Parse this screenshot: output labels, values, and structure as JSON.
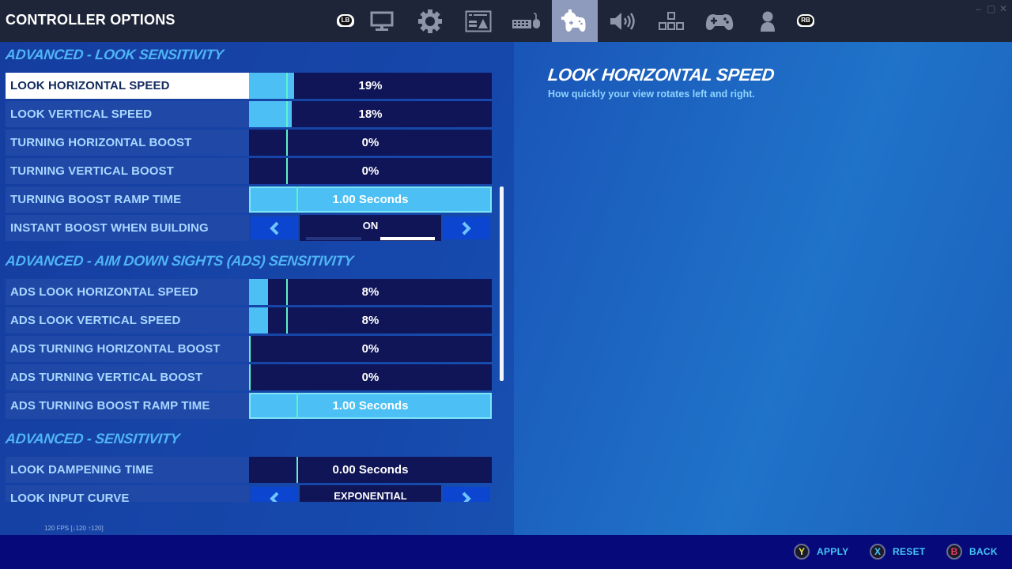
{
  "header": {
    "title": "CONTROLLER OPTIONS",
    "left_bumper": "LB",
    "right_bumper": "RB",
    "tabs": [
      {
        "icon": "monitor-icon",
        "name": "display"
      },
      {
        "icon": "gear-icon",
        "name": "game"
      },
      {
        "icon": "brightness-icon",
        "name": "brightness"
      },
      {
        "icon": "keyboard-mouse-icon",
        "name": "keyboard-controls"
      },
      {
        "icon": "controller-gear-icon",
        "name": "controller-options",
        "active": true
      },
      {
        "icon": "speaker-icon",
        "name": "audio"
      },
      {
        "icon": "dpad-icon",
        "name": "touch-input"
      },
      {
        "icon": "gamepad-icon",
        "name": "controller"
      },
      {
        "icon": "person-icon",
        "name": "account"
      }
    ],
    "window_controls": {
      "minimize": "–",
      "maximize": "▢",
      "close": "✕"
    }
  },
  "sections": [
    {
      "title": "ADVANCED - LOOK SENSITIVITY",
      "rows": [
        {
          "label": "LOOK HORIZONTAL SPEED",
          "type": "slider",
          "value": "19%",
          "fraction": 0.19,
          "selected": true
        },
        {
          "label": "LOOK VERTICAL SPEED",
          "type": "slider",
          "value": "18%",
          "fraction": 0.18
        },
        {
          "label": "TURNING HORIZONTAL BOOST",
          "type": "slider",
          "value": "0%",
          "fraction": 0.0
        },
        {
          "label": "TURNING VERTICAL BOOST",
          "type": "slider",
          "value": "0%",
          "fraction": 0.0
        },
        {
          "label": "TURNING BOOST RAMP TIME",
          "type": "slider",
          "value": "1.00 Seconds",
          "fraction": 1.0
        },
        {
          "label": "INSTANT BOOST WHEN BUILDING",
          "type": "toggle",
          "value": "ON",
          "option_index": 1,
          "option_count": 2
        }
      ]
    },
    {
      "title": "ADVANCED - AIM DOWN SIGHTS (ADS) SENSITIVITY",
      "rows": [
        {
          "label": "ADS LOOK HORIZONTAL SPEED",
          "type": "slider",
          "value": "8%",
          "fraction": 0.08
        },
        {
          "label": "ADS LOOK VERTICAL SPEED",
          "type": "slider",
          "value": "8%",
          "fraction": 0.08
        },
        {
          "label": "ADS TURNING HORIZONTAL BOOST",
          "type": "slider",
          "value": "0%",
          "fraction": 0.0
        },
        {
          "label": "ADS TURNING VERTICAL BOOST",
          "type": "slider",
          "value": "0%",
          "fraction": 0.0
        },
        {
          "label": "ADS TURNING BOOST RAMP TIME",
          "type": "slider",
          "value": "1.00 Seconds",
          "fraction": 1.0
        }
      ]
    },
    {
      "title": "ADVANCED - SENSITIVITY",
      "rows": [
        {
          "label": "LOOK DAMPENING TIME",
          "type": "slider",
          "value": "0.00 Seconds",
          "fraction": 0.0
        },
        {
          "label": "LOOK INPUT CURVE",
          "type": "selector",
          "value": "EXPONENTIAL"
        }
      ]
    }
  ],
  "detail": {
    "title": "LOOK HORIZONTAL SPEED",
    "description": "How quickly your view rotates left and right."
  },
  "fps_readout": "120 FPS [↓120 ↑120]",
  "footer": {
    "buttons": [
      {
        "glyph": "Y",
        "label": "APPLY",
        "color": "#e8e84a"
      },
      {
        "glyph": "X",
        "label": "RESET",
        "color": "#44c8f5"
      },
      {
        "glyph": "B",
        "label": "BACK",
        "color": "#ee3a5c"
      }
    ]
  },
  "colors": {
    "fill": "#4cc0f5",
    "marker": "#5ef2c8",
    "track": "#0f1557",
    "section_title": "#4fb4f5"
  }
}
